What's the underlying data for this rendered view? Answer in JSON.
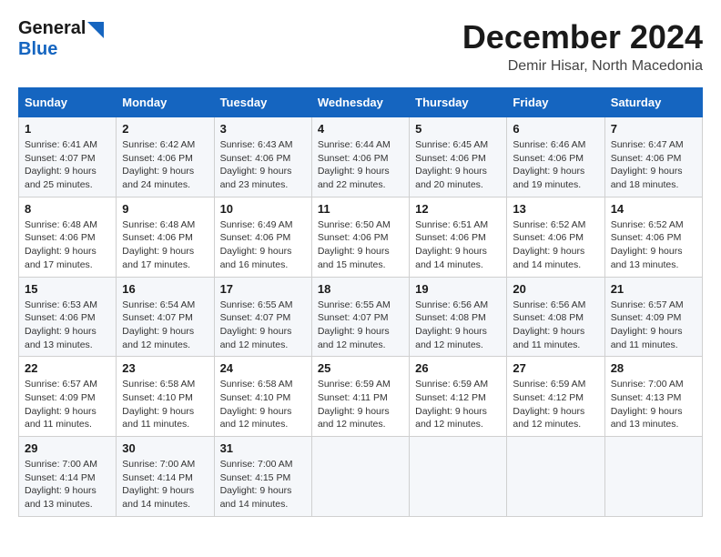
{
  "logo": {
    "text_general": "General",
    "text_blue": "Blue"
  },
  "title": "December 2024",
  "location": "Demir Hisar, North Macedonia",
  "days_of_week": [
    "Sunday",
    "Monday",
    "Tuesday",
    "Wednesday",
    "Thursday",
    "Friday",
    "Saturday"
  ],
  "weeks": [
    [
      {
        "day": "1",
        "sunrise": "6:41 AM",
        "sunset": "4:07 PM",
        "daylight": "9 hours and 25 minutes."
      },
      {
        "day": "2",
        "sunrise": "6:42 AM",
        "sunset": "4:06 PM",
        "daylight": "9 hours and 24 minutes."
      },
      {
        "day": "3",
        "sunrise": "6:43 AM",
        "sunset": "4:06 PM",
        "daylight": "9 hours and 23 minutes."
      },
      {
        "day": "4",
        "sunrise": "6:44 AM",
        "sunset": "4:06 PM",
        "daylight": "9 hours and 22 minutes."
      },
      {
        "day": "5",
        "sunrise": "6:45 AM",
        "sunset": "4:06 PM",
        "daylight": "9 hours and 20 minutes."
      },
      {
        "day": "6",
        "sunrise": "6:46 AM",
        "sunset": "4:06 PM",
        "daylight": "9 hours and 19 minutes."
      },
      {
        "day": "7",
        "sunrise": "6:47 AM",
        "sunset": "4:06 PM",
        "daylight": "9 hours and 18 minutes."
      }
    ],
    [
      {
        "day": "8",
        "sunrise": "6:48 AM",
        "sunset": "4:06 PM",
        "daylight": "9 hours and 17 minutes."
      },
      {
        "day": "9",
        "sunrise": "6:48 AM",
        "sunset": "4:06 PM",
        "daylight": "9 hours and 17 minutes."
      },
      {
        "day": "10",
        "sunrise": "6:49 AM",
        "sunset": "4:06 PM",
        "daylight": "9 hours and 16 minutes."
      },
      {
        "day": "11",
        "sunrise": "6:50 AM",
        "sunset": "4:06 PM",
        "daylight": "9 hours and 15 minutes."
      },
      {
        "day": "12",
        "sunrise": "6:51 AM",
        "sunset": "4:06 PM",
        "daylight": "9 hours and 14 minutes."
      },
      {
        "day": "13",
        "sunrise": "6:52 AM",
        "sunset": "4:06 PM",
        "daylight": "9 hours and 14 minutes."
      },
      {
        "day": "14",
        "sunrise": "6:52 AM",
        "sunset": "4:06 PM",
        "daylight": "9 hours and 13 minutes."
      }
    ],
    [
      {
        "day": "15",
        "sunrise": "6:53 AM",
        "sunset": "4:06 PM",
        "daylight": "9 hours and 13 minutes."
      },
      {
        "day": "16",
        "sunrise": "6:54 AM",
        "sunset": "4:07 PM",
        "daylight": "9 hours and 12 minutes."
      },
      {
        "day": "17",
        "sunrise": "6:55 AM",
        "sunset": "4:07 PM",
        "daylight": "9 hours and 12 minutes."
      },
      {
        "day": "18",
        "sunrise": "6:55 AM",
        "sunset": "4:07 PM",
        "daylight": "9 hours and 12 minutes."
      },
      {
        "day": "19",
        "sunrise": "6:56 AM",
        "sunset": "4:08 PM",
        "daylight": "9 hours and 12 minutes."
      },
      {
        "day": "20",
        "sunrise": "6:56 AM",
        "sunset": "4:08 PM",
        "daylight": "9 hours and 11 minutes."
      },
      {
        "day": "21",
        "sunrise": "6:57 AM",
        "sunset": "4:09 PM",
        "daylight": "9 hours and 11 minutes."
      }
    ],
    [
      {
        "day": "22",
        "sunrise": "6:57 AM",
        "sunset": "4:09 PM",
        "daylight": "9 hours and 11 minutes."
      },
      {
        "day": "23",
        "sunrise": "6:58 AM",
        "sunset": "4:10 PM",
        "daylight": "9 hours and 11 minutes."
      },
      {
        "day": "24",
        "sunrise": "6:58 AM",
        "sunset": "4:10 PM",
        "daylight": "9 hours and 12 minutes."
      },
      {
        "day": "25",
        "sunrise": "6:59 AM",
        "sunset": "4:11 PM",
        "daylight": "9 hours and 12 minutes."
      },
      {
        "day": "26",
        "sunrise": "6:59 AM",
        "sunset": "4:12 PM",
        "daylight": "9 hours and 12 minutes."
      },
      {
        "day": "27",
        "sunrise": "6:59 AM",
        "sunset": "4:12 PM",
        "daylight": "9 hours and 12 minutes."
      },
      {
        "day": "28",
        "sunrise": "7:00 AM",
        "sunset": "4:13 PM",
        "daylight": "9 hours and 13 minutes."
      }
    ],
    [
      {
        "day": "29",
        "sunrise": "7:00 AM",
        "sunset": "4:14 PM",
        "daylight": "9 hours and 13 minutes."
      },
      {
        "day": "30",
        "sunrise": "7:00 AM",
        "sunset": "4:14 PM",
        "daylight": "9 hours and 14 minutes."
      },
      {
        "day": "31",
        "sunrise": "7:00 AM",
        "sunset": "4:15 PM",
        "daylight": "9 hours and 14 minutes."
      },
      null,
      null,
      null,
      null
    ]
  ],
  "labels": {
    "sunrise": "Sunrise:",
    "sunset": "Sunset:",
    "daylight": "Daylight:"
  }
}
